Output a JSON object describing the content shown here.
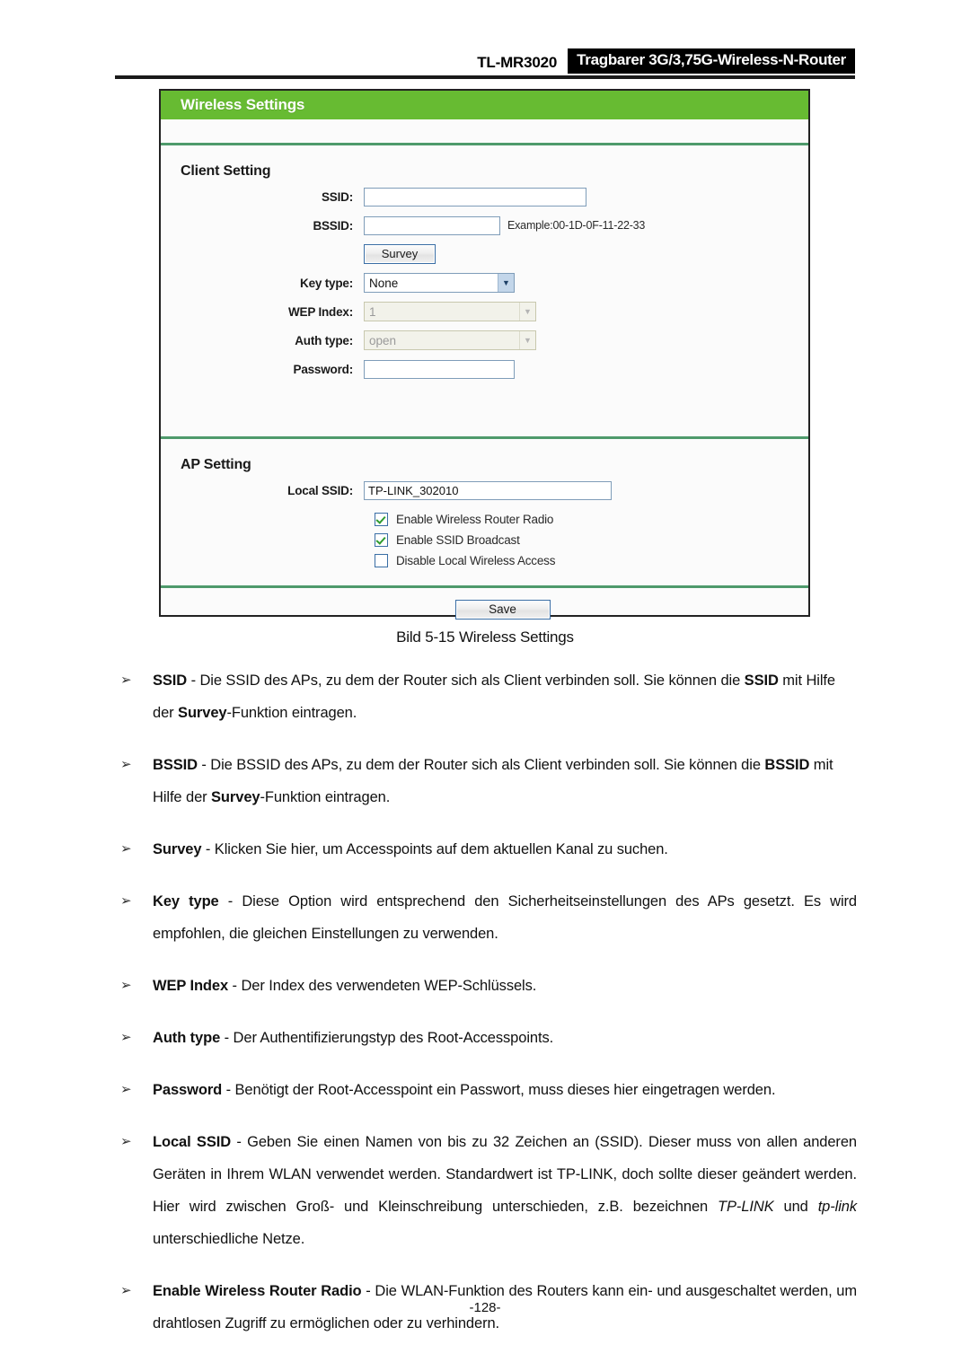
{
  "header": {
    "model": "TL-MR3020",
    "product_title": "Tragbarer 3G/3,75G-Wireless-N-Router"
  },
  "panel": {
    "title": "Wireless Settings",
    "accent_green": "#67bb32",
    "divider_green": "#4e9a6b",
    "client_section": {
      "title": "Client Setting",
      "fields": {
        "ssid_label": "SSID:",
        "ssid_value": "",
        "bssid_label": "BSSID:",
        "bssid_value": "",
        "bssid_hint": "Example:00-1D-0F-11-22-33",
        "survey_button": "Survey",
        "keytype_label": "Key type:",
        "keytype_value": "None",
        "wepindex_label": "WEP Index:",
        "wepindex_value": "1",
        "authtype_label": "Auth type:",
        "authtype_value": "open",
        "password_label": "Password:",
        "password_value": ""
      }
    },
    "ap_section": {
      "title": "AP Setting",
      "local_ssid_label": "Local SSID:",
      "local_ssid_value": "TP-LINK_302010",
      "checkboxes": [
        {
          "label": "Enable Wireless Router Radio",
          "checked": true
        },
        {
          "label": "Enable SSID Broadcast",
          "checked": true
        },
        {
          "label": "Disable Local Wireless Access",
          "checked": false
        }
      ]
    },
    "save_button": "Save"
  },
  "caption": "Bild 5-15 Wireless Settings",
  "bullets": {
    "marker": "➢",
    "items": {
      "ssid": {
        "p1_b": "SSID",
        "p1": " - Die SSID des APs, zu dem der Router sich als Client verbinden soll. Sie können die ",
        "p2_b": "SSID",
        "p2": " mit Hilfe der ",
        "p3_b": "Survey",
        "p3": "-Funktion eintragen."
      },
      "bssid": {
        "p1_b": "BSSID",
        "p1": " - Die BSSID des APs, zu dem der Router sich als Client verbinden soll. Sie können die ",
        "p2_b": "BSSID",
        "p2": " mit Hilfe der ",
        "p3_b": "Survey",
        "p3": "-Funktion eintragen."
      },
      "survey": {
        "p1_b": "Survey",
        "p1": " - Klicken Sie hier, um Accesspoints auf dem aktuellen Kanal zu suchen."
      },
      "keytype": {
        "p1_b": "Key type",
        "p1": " - Diese Option wird entsprechend den Sicherheitseinstellungen des APs gesetzt. Es wird empfohlen, die gleichen Einstellungen zu verwenden."
      },
      "wepindex": {
        "p1_b": "WEP Index",
        "p1": " - Der Index des verwendeten WEP-Schlüssels."
      },
      "authtype": {
        "p1_b": "Auth type",
        "p1": " - Der Authentifizierungstyp des Root-Accesspoints."
      },
      "password": {
        "p1_b": "Password",
        "p1": " - Benötigt der Root-Accesspoint ein Passwort, muss dieses hier eingetragen werden."
      },
      "localssid": {
        "p1_b": "Local SSID",
        "p1": " - Geben Sie einen Namen von bis zu 32 Zeichen an (SSID). Dieser muss von allen anderen Geräten in Ihrem WLAN verwendet werden. Standardwert ist TP-LINK, doch sollte dieser geändert werden. Hier wird zwischen Groß- und Kleinschreibung unterschieden, z.B. bezeichnen ",
        "p2_i": "TP-LINK",
        "p2": " und ",
        "p3_i": "tp-link",
        "p3": " unterschiedliche Netze."
      },
      "radio": {
        "p1_b": "Enable Wireless Router Radio",
        "p1": " - Die WLAN-Funktion des Routers kann ein- und ausgeschaltet werden, um drahtlosen Zugriff zu ermöglichen oder zu verhindern."
      }
    }
  },
  "footer": {
    "page_number": "-128-"
  }
}
